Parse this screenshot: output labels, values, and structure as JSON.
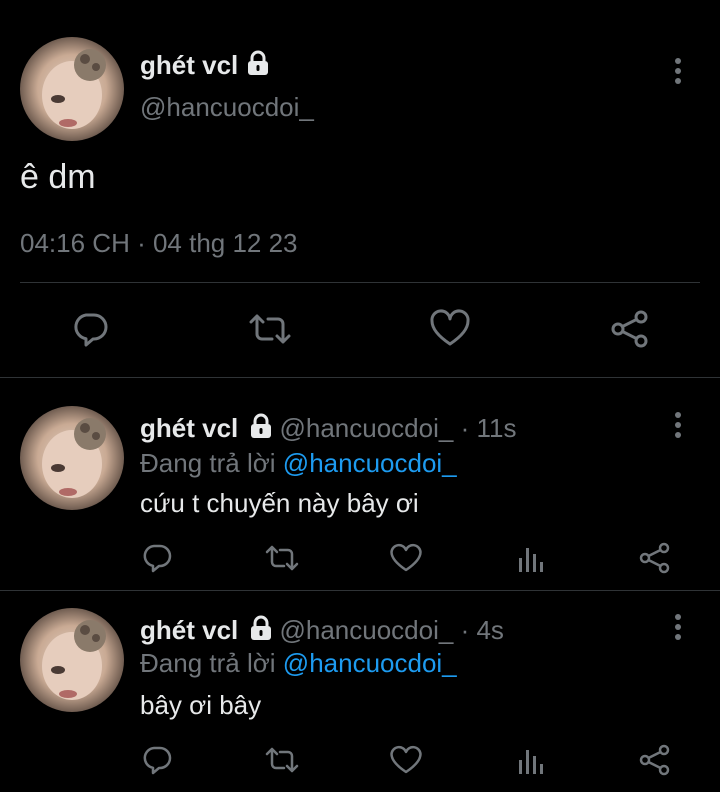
{
  "main_tweet": {
    "display_name": "ghét vcl",
    "handle": "@hancuocdoi_",
    "text": "ê dm",
    "timestamp": "04:16 CH · 04 thg 12 23",
    "lock_icon": "lock-icon",
    "actions": [
      "reply-icon",
      "retweet-icon",
      "like-icon",
      "share-icon"
    ]
  },
  "replies": [
    {
      "display_name": "ghét vcl",
      "handle": "@hancuocdoi_",
      "time": "· 11s",
      "replying_prefix": "Đang trả lời",
      "replying_to": "@hancuocdoi_",
      "text": "cứu t chuyến này bây ơi"
    },
    {
      "display_name": "ghét vcl",
      "handle": "@hancuocdoi_",
      "time": "· 4s",
      "replying_prefix": "Đang trả lời",
      "replying_to": "@hancuocdoi_",
      "text": "bây ơi bây"
    }
  ],
  "colors": {
    "background": "#000000",
    "text": "#e7e9ea",
    "muted": "#71767b",
    "accent": "#1d9bf0"
  }
}
